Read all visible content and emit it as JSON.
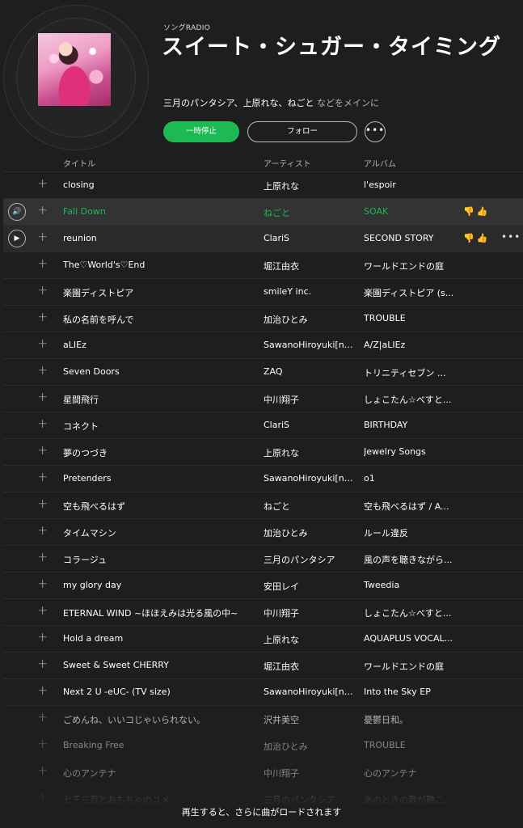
{
  "header": {
    "kicker": "ソングRADIO",
    "title": "スイート・シュガー・タイミング",
    "subtitle_artists": "三月のパンタシア、上原れな、ねごと",
    "subtitle_suffix": " などをメインに",
    "cover_icon": "album-cover-image"
  },
  "actions": {
    "pause_label": "一時停止",
    "follow_label": "フォロー",
    "more_label": "•••"
  },
  "columns": {
    "title": "タイトル",
    "artist": "アーティスト",
    "album": "アルバム"
  },
  "icons": {
    "add": "+",
    "speaker": "🔊",
    "play": "▶",
    "thumbs": "👎👍",
    "row_more": "•••"
  },
  "colors": {
    "accent": "#1db954",
    "background": "#1e1e1e"
  },
  "tracks": [
    {
      "title": "closing",
      "artist": "上原れな",
      "album": "l'espoir"
    },
    {
      "title": "Fall Down",
      "artist": "ねごと",
      "album": "SOAK"
    },
    {
      "title": "reunion",
      "artist": "ClariS",
      "album": "SECOND STORY"
    },
    {
      "title": "The♡World's♡End",
      "artist": "堀江由衣",
      "album": "ワールドエンドの庭"
    },
    {
      "title": "楽園ディストピア",
      "artist": "smileY inc.",
      "album": "楽園ディストピア (s..."
    },
    {
      "title": "私の名前を呼んで",
      "artist": "加治ひとみ",
      "album": "TROUBLE"
    },
    {
      "title": "aLIEz",
      "artist": "SawanoHiroyuki[nZk...",
      "album": "A/Z|aLIEz"
    },
    {
      "title": "Seven Doors",
      "artist": "ZAQ",
      "album": "トリニティセブン ..."
    },
    {
      "title": "星間飛行",
      "artist": "中川翔子",
      "album": "しょこたん☆べすと..."
    },
    {
      "title": "コネクト",
      "artist": "ClariS",
      "album": "BIRTHDAY"
    },
    {
      "title": "夢のつづき",
      "artist": "上原れな",
      "album": "Jewelry Songs"
    },
    {
      "title": "Pretenders",
      "artist": "SawanoHiroyuki[nZk...",
      "album": "o1"
    },
    {
      "title": "空も飛べるはず",
      "artist": "ねごと",
      "album": "空も飛べるはず / A..."
    },
    {
      "title": "タイムマシン",
      "artist": "加治ひとみ",
      "album": "ルール違反"
    },
    {
      "title": "コラージュ",
      "artist": "三月のパンタシア",
      "album": "風の声を聴きながら..."
    },
    {
      "title": "my glory day",
      "artist": "安田レイ",
      "album": "Tweedia"
    },
    {
      "title": "ETERNAL WIND ~ほほえみは光る風の中~",
      "artist": "中川翔子",
      "album": "しょこたん☆べすと..."
    },
    {
      "title": "Hold a dream",
      "artist": "上原れな",
      "album": "AQUAPLUS VOCAL..."
    },
    {
      "title": "Sweet & Sweet CHERRY",
      "artist": "堀江由衣",
      "album": "ワールドエンドの庭"
    },
    {
      "title": "Next 2 U -eUC- (TV size)",
      "artist": "SawanoHiroyuki[nZk...",
      "album": "Into the Sky EP"
    },
    {
      "title": "ごめんね、いいコじゃいられない。",
      "artist": "沢井美空",
      "album": "憂鬱日和。"
    },
    {
      "title": "Breaking Free",
      "artist": "加治ひとみ",
      "album": "TROUBLE"
    },
    {
      "title": "心のアンテナ",
      "artist": "中川翔子",
      "album": "心のアンテナ"
    },
    {
      "title": "七千三百とおもちゃのユメ",
      "artist": "三月のパンタシア",
      "album": "あのときの歌が聴こ..."
    }
  ],
  "footer": {
    "text": "再生すると、さらに曲がロードされます"
  }
}
